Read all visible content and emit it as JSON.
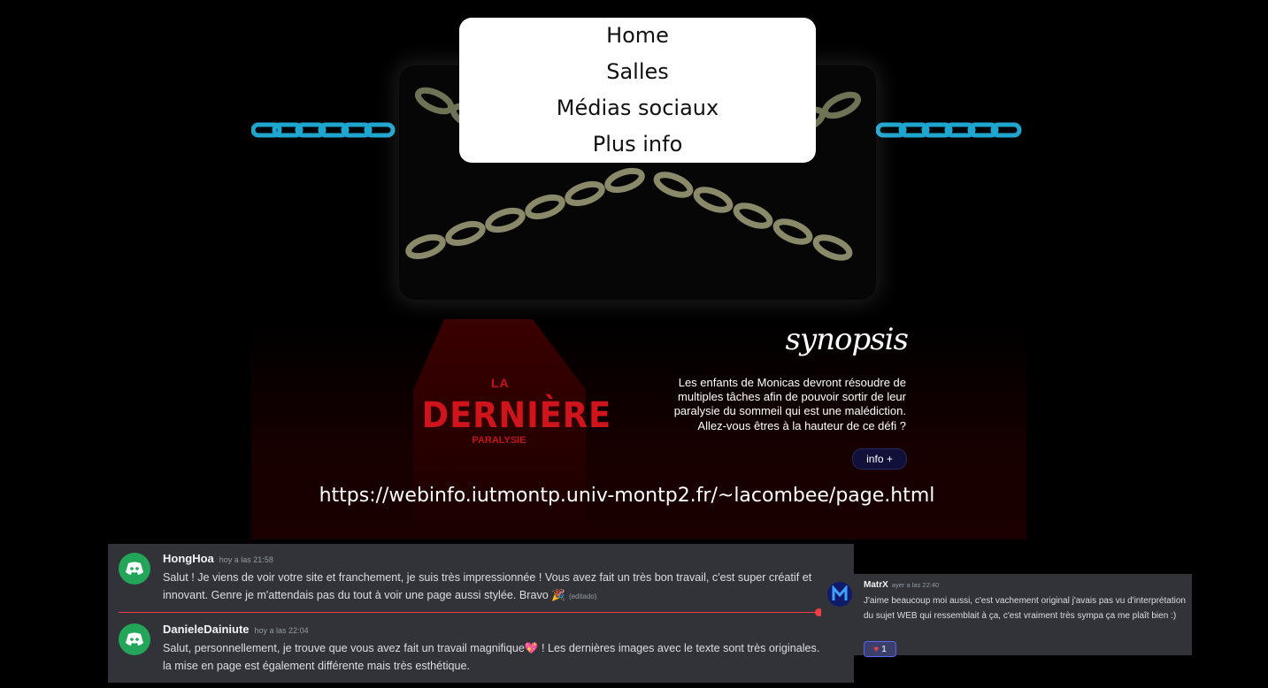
{
  "nav": {
    "items": [
      {
        "label": "Home"
      },
      {
        "label": "Salles"
      },
      {
        "label": "Médias sociaux"
      },
      {
        "label": "Plus info"
      }
    ]
  },
  "logo": {
    "top": "LA",
    "main": "DERNIÈRE",
    "sub": "PARALYSIE"
  },
  "synopsis": {
    "title": "synopsis",
    "text": "Les enfants de Monicas devront résoudre de multiples tâches afin de pouvoir sortir de leur paralysie du sommeil qui est une malédiction. Allez-vous êtres à la hauteur de ce défi ?",
    "button": "info +"
  },
  "url": "https://webinfo.iutmontp.univ-montp2.fr/~lacombee/page.html",
  "chat": {
    "messages": [
      {
        "author": "HongHoa",
        "time": "hoy a las 21:58",
        "text": "Salut ! Je viens de voir votre site et franchement, je suis très impressionnée ! Vous avez fait un très bon travail, c'est super créatif et innovant. Genre je m'attendais pas du tout à voir une page aussi stylée. Bravo 🎉",
        "edited": "(editado)"
      },
      {
        "author": "DanieleDainiute",
        "time": "hoy a las 22:04",
        "text": "Salut, personnellement, je trouve que vous avez fait un travail magnifique💖 ! Les dernières images avec le texte sont très originales. Et la mise en page est également différente mais très esthétique."
      }
    ]
  },
  "chat2": {
    "author": "MatrX",
    "time": "ayer a las 22:40",
    "text": "J'aime beaucoup moi aussi, c'est vachement original j'avais pas vu d'interprétation du sujet WEB qui ressemblait à ça, c'est vraiment très sympa ça me plaît bien :)",
    "reaction_count": "1"
  },
  "colors": {
    "accent_red": "#d0141b",
    "discord_green": "#23a55a",
    "discord_bg": "#313338",
    "chain_blue": "#1fa6cf"
  },
  "icons": [
    "discord-icon",
    "heart-icon",
    "chain-image"
  ]
}
